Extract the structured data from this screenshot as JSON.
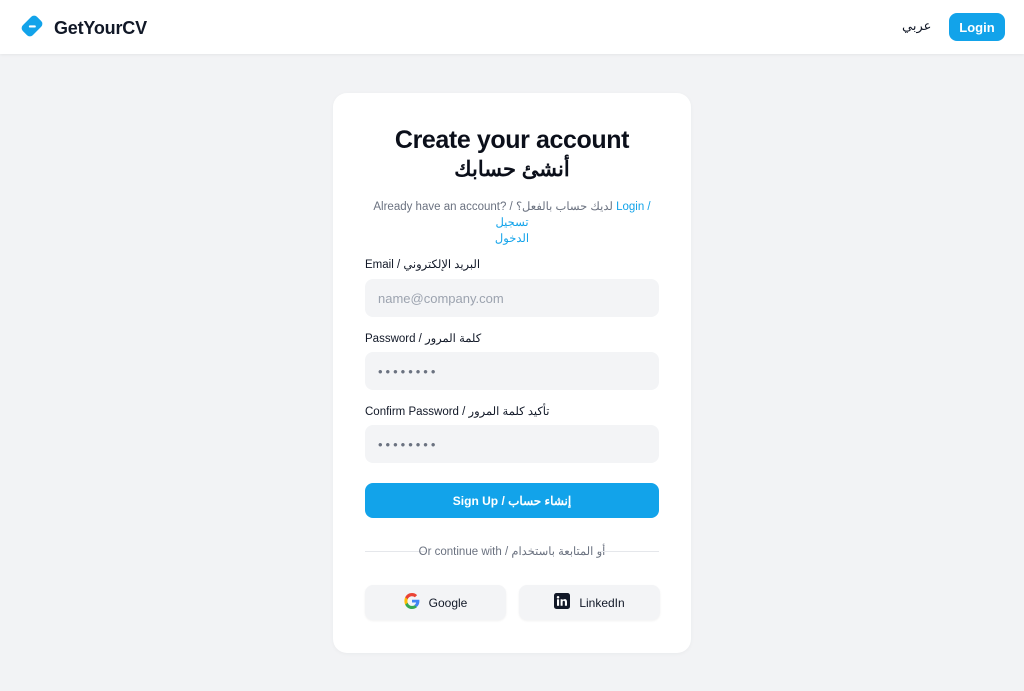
{
  "header": {
    "brand_name": "GetYourCV",
    "lang_toggle": "عربي",
    "login_label": "Login",
    "accent_color": "#12a3ea"
  },
  "card": {
    "title_en": "Create your account",
    "title_ar": "أنشئ حسابك",
    "have_account": "Already have an account? / لديك حساب بالفعل؟",
    "login_link": "Login / تسجيل",
    "login_link_line2": "الدخول",
    "email": {
      "label": "Email / البريد الإلكتروني",
      "placeholder": "name@company.com",
      "value": ""
    },
    "password": {
      "label": "Password / كلمة المرور",
      "value": "••••••••"
    },
    "confirm_password": {
      "label": "Confirm Password / تأكيد كلمة المرور",
      "value": "••••••••"
    },
    "signup_label": "Sign Up / إنشاء حساب",
    "divider_text": "Or continue with / أو المتابعة باستخدام",
    "social": [
      {
        "label": "Google",
        "icon": "google-icon"
      },
      {
        "label": "LinkedIn",
        "icon": "linkedin-icon"
      }
    ]
  }
}
